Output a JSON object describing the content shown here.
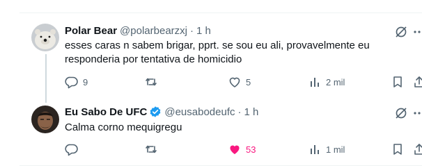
{
  "tweets": [
    {
      "name": "Polar Bear",
      "handle": "@polarbearzxj",
      "separator": "·",
      "time": "1 h",
      "text": "esses caras n sabem brigar, pprt. se sou eu ali, provavelmente eu responderia por tentativa de homicidio",
      "replies": "9",
      "retweets": "",
      "likes": "5",
      "views": "2 mil",
      "liked": false,
      "verified": false
    },
    {
      "name": "Eu Sabo De UFC",
      "handle": "@eusabodeufc",
      "separator": "·",
      "time": "1 h",
      "text": "Calma corno mequigregu",
      "replies": "",
      "retweets": "",
      "likes": "53",
      "views": "1 mil",
      "liked": true,
      "verified": true
    }
  ],
  "colors": {
    "text": "#0f1419",
    "secondary": "#536471",
    "like": "#f91880",
    "verified": "#1d9bf0",
    "divider": "#eff3f4"
  },
  "icons": [
    "grok-icon",
    "more-icon",
    "reply-icon",
    "retweet-icon",
    "heart-icon",
    "views-icon",
    "bookmark-icon",
    "share-icon",
    "verified-badge-icon"
  ]
}
